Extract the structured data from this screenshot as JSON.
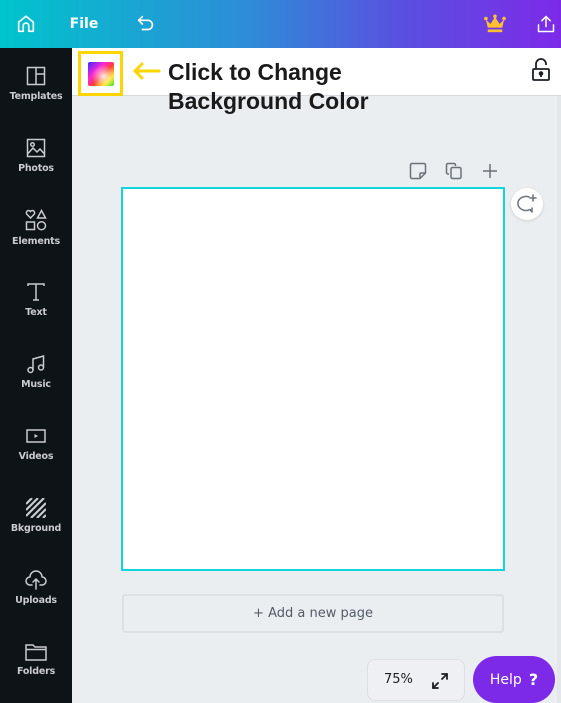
{
  "topbar": {
    "icons": [
      "home-icon",
      "undo-icon",
      "crown-icon",
      "share-icon"
    ],
    "file_label": "File",
    "gradient_start": "#00c4cc",
    "gradient_end": "#7d2ae8"
  },
  "sidebar": {
    "items": [
      {
        "label": "Templates",
        "icon": "templates-icon"
      },
      {
        "label": "Photos",
        "icon": "photos-icon"
      },
      {
        "label": "Elements",
        "icon": "elements-icon"
      },
      {
        "label": "Text",
        "icon": "text-icon"
      },
      {
        "label": "Music",
        "icon": "music-icon"
      },
      {
        "label": "Videos",
        "icon": "videos-icon"
      },
      {
        "label": "Bkground",
        "icon": "background-icon"
      },
      {
        "label": "Uploads",
        "icon": "uploads-icon"
      },
      {
        "label": "Folders",
        "icon": "folders-icon"
      }
    ]
  },
  "editor_toolbar": {
    "color_picker_icon": "color-palette-icon",
    "annotation_line1": "Click to Change",
    "annotation_line2": "Background Color",
    "annotation_color": "#ffd500",
    "lock_icon": "unlock-icon"
  },
  "page_actions": {
    "icons": [
      "add-note-icon",
      "duplicate-page-icon",
      "add-page-icon"
    ]
  },
  "canvas": {
    "border_color": "#13d3dc",
    "background": "#ffffff"
  },
  "add_page_label": "+ Add a new page",
  "footer": {
    "zoom_level": "75%",
    "fullscreen_icon": "expand-icon",
    "help_label": "Help",
    "help_symbol": "?",
    "help_color": "#7d2ae8"
  }
}
